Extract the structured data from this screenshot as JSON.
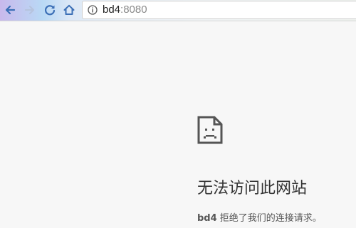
{
  "browser": {
    "address_bar": {
      "host": "bd4",
      "port": ":8080"
    },
    "icons": {
      "back": "back-arrow-icon",
      "forward": "forward-arrow-icon",
      "reload": "reload-icon",
      "home": "home-icon",
      "site_info": "info-icon"
    },
    "colors": {
      "nav_icon": "#3b6fb6",
      "nav_icon_disabled": "#b6c4de"
    }
  },
  "error_page": {
    "icon": "sad-document-icon",
    "title": "无法访问此网站",
    "desc_host": "bd4",
    "desc_text": " 拒绝了我们的连接请求。"
  }
}
